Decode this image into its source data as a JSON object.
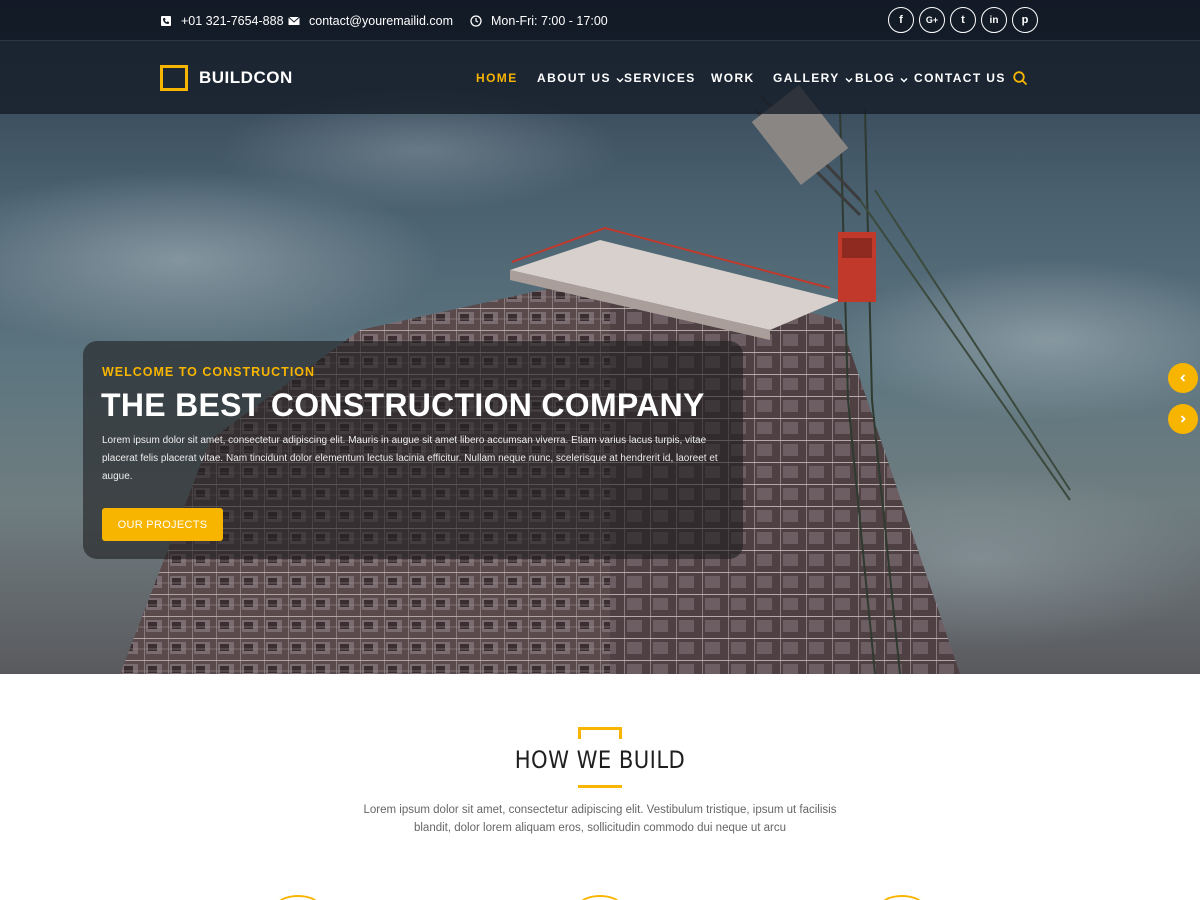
{
  "topbar": {
    "phone": "+01 321-7654-888",
    "email": "contact@youremailid.com",
    "hours": "Mon-Fri: 7:00 - 17:00",
    "social": [
      {
        "icon": "facebook-icon",
        "glyph": "f"
      },
      {
        "icon": "google-plus-icon",
        "glyph": "G+"
      },
      {
        "icon": "twitter-icon",
        "glyph": "t"
      },
      {
        "icon": "linkedin-icon",
        "glyph": "in"
      },
      {
        "icon": "pinterest-icon",
        "glyph": "p"
      }
    ]
  },
  "brand": {
    "name": "BUILDCON"
  },
  "nav": {
    "items": [
      {
        "label": "HOME",
        "active": true
      },
      {
        "label": "ABOUT US",
        "dropdown": true
      },
      {
        "label": "SERVICES"
      },
      {
        "label": "WORK"
      },
      {
        "label": "GALLERY",
        "dropdown": true
      },
      {
        "label": "BLOG",
        "dropdown": true
      },
      {
        "label": "CONTACT US"
      }
    ],
    "search_icon": "search-icon"
  },
  "hero": {
    "kicker": "WELCOME TO CONSTRUCTION",
    "title": "THE BEST CONSTRUCTION COMPANY",
    "text": "Lorem ipsum dolor sit amet, consectetur adipiscing elit. Mauris in augue sit amet libero accumsan viverra. Etiam varius lacus turpis, vitae placerat felis placerat vitae. Nam tincidunt dolor elementum lectus lacinia efficitur. Nullam neque nunc, scelerisque at hendrerit id, laoreet et augue.",
    "button_label": "OUR PROJECTS"
  },
  "section": {
    "title": "HOW WE BUILD",
    "text": "Lorem ipsum dolor sit amet, consectetur adipiscing elit. Vestibulum tristique, ipsum ut facilisis blandit, dolor lorem aliquam eros, sollicitudin commodo dui neque ut arcu"
  },
  "colors": {
    "accent": "#f8b500",
    "dark": "#141c28"
  }
}
